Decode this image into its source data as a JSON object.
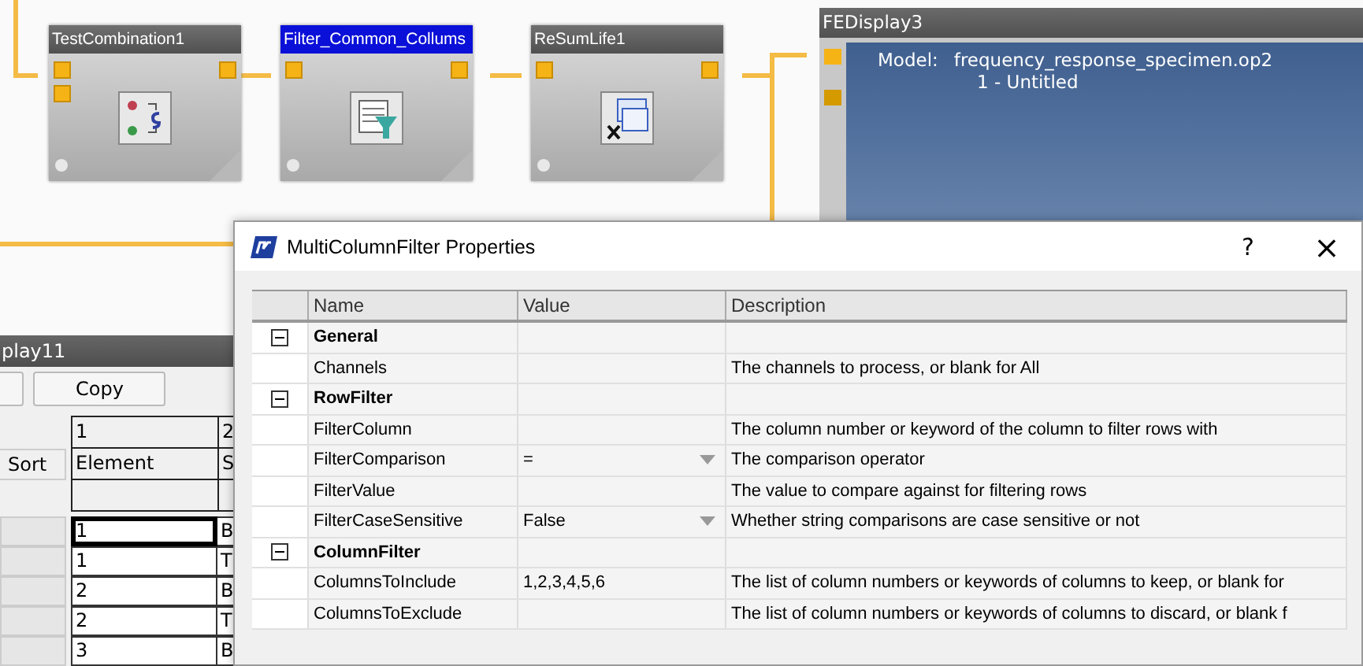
{
  "canvas": {
    "nodes": [
      {
        "title": "TestCombination1",
        "selected": false,
        "kind": "combine"
      },
      {
        "title": "Filter_Common_Collums",
        "selected": true,
        "kind": "filter"
      },
      {
        "title": "ReSumLife1",
        "selected": false,
        "kind": "resum"
      }
    ],
    "display": {
      "title": "FEDisplay3",
      "model_label": "Model:",
      "model_value": "frequency_response_specimen.op2",
      "subtitle": "1 - Untitled"
    }
  },
  "background_window": {
    "title": "play11",
    "buttons": [
      "Copy"
    ],
    "sort_button": "Sort",
    "header_rows": [
      [
        "1",
        "2"
      ],
      [
        "Element",
        "S"
      ]
    ],
    "rows": [
      {
        "cells": [
          "1",
          "B"
        ],
        "selected": true
      },
      {
        "cells": [
          "1",
          "T"
        ],
        "selected": false
      },
      {
        "cells": [
          "2",
          "B"
        ],
        "selected": false
      },
      {
        "cells": [
          "2",
          "T"
        ],
        "selected": false
      },
      {
        "cells": [
          "3",
          "B"
        ],
        "selected": false
      }
    ]
  },
  "dialog": {
    "title": "MultiColumnFilter Properties",
    "help": "?",
    "close": "×",
    "columns": [
      "Name",
      "Value",
      "Description"
    ],
    "groups": [
      {
        "name": "General",
        "expanded": true,
        "children": [
          {
            "name": "Channels",
            "kind": "text",
            "description": "The channels to process, or blank for All"
          }
        ]
      },
      {
        "name": "RowFilter",
        "expanded": true,
        "children": [
          {
            "name": "FilterColumn",
            "kind": "text",
            "description": "The column number or keyword of the column to filter rows with"
          },
          {
            "name": "FilterComparison",
            "kind": "dropdown",
            "value": "=",
            "description": "The comparison operator"
          },
          {
            "name": "FilterValue",
            "kind": "text",
            "description": "The value to compare against for filtering rows"
          },
          {
            "name": "FilterCaseSensitive",
            "kind": "dropdown",
            "value": "False",
            "description": "Whether string comparisons are case sensitive or not"
          }
        ]
      },
      {
        "name": "ColumnFilter",
        "expanded": true,
        "children": [
          {
            "name": "ColumnsToInclude",
            "kind": "text",
            "value": "1,2,3,4,5,6",
            "description": "The list of column numbers or keywords of columns to keep, or blank for"
          },
          {
            "name": "ColumnsToExclude",
            "kind": "text",
            "description": "The list of column numbers or keywords of columns to discard, or blank f"
          }
        ]
      }
    ]
  }
}
